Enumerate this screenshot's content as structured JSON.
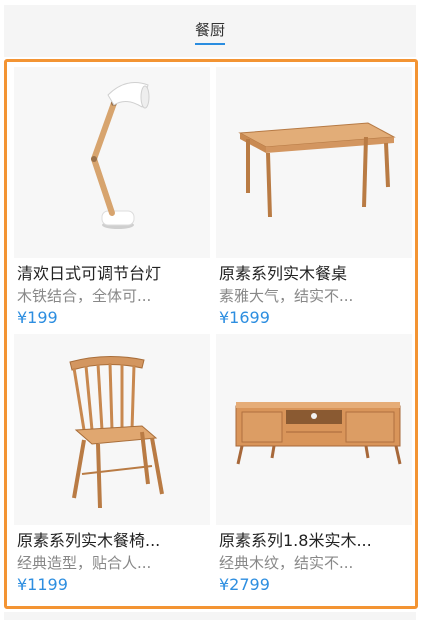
{
  "tabs": {
    "active": "餐厨"
  },
  "products": [
    {
      "title": "清欢日式可调节台灯",
      "desc": "木铁结合，全体可...",
      "price": "¥199",
      "icon": "desk-lamp"
    },
    {
      "title": "原素系列实木餐桌",
      "desc": "素雅大气，结实不...",
      "price": "¥1699",
      "icon": "dining-table"
    },
    {
      "title": "原素系列实木餐椅...",
      "desc": "经典造型，贴合人...",
      "price": "¥1199",
      "icon": "wooden-chair"
    },
    {
      "title": "原素系列1.8米实木...",
      "desc": "经典木纹，结实不...",
      "price": "¥2799",
      "icon": "tv-cabinet"
    }
  ],
  "colors": {
    "accent": "#2d8ee0",
    "highlight_border": "#f39433",
    "wood": "#d9a06a"
  }
}
